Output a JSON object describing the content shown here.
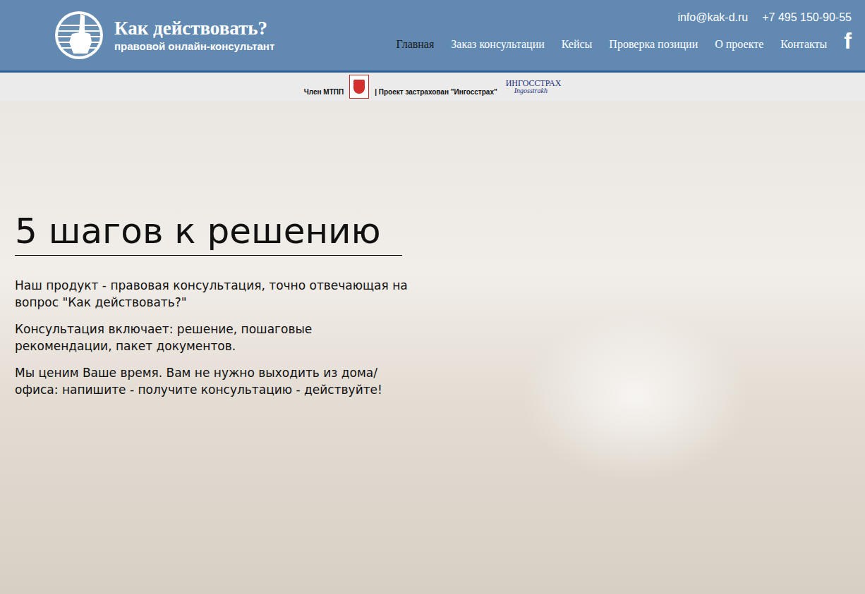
{
  "logo": {
    "title": "Как действовать?",
    "subtitle": "правовой онлайн-консультант"
  },
  "contacts": {
    "email": "info@kak-d.ru",
    "phone": "+7 495 150-90-55"
  },
  "nav": [
    {
      "label": "Главная",
      "selected": true
    },
    {
      "label": "Заказ консультации",
      "selected": false
    },
    {
      "label": "Кейсы",
      "selected": false
    },
    {
      "label": "Проверка позиции",
      "selected": false
    },
    {
      "label": "О проекте",
      "selected": false
    },
    {
      "label": "Контакты",
      "selected": false
    }
  ],
  "social": {
    "icon": "f"
  },
  "badges": {
    "member": "Член МТПП",
    "insured": "| Проект застрахован \"Ингосстрах\"",
    "insurer_logo": "ИНГОССТРАХ",
    "insurer_logo_sub": "Ingosstrakh"
  },
  "hero": {
    "title": "5 шагов к решению",
    "paragraphs": [
      "Наш продукт - правовая консультация, точно отвечающая на вопрос \"Как действовать?\"",
      "Консультация включает: решение, пошаговые рекомендации, пакет документов.",
      "Мы ценим Ваше время. Вам не нужно выходить из дома/офиса: напишите - получите консультацию - действуйте!"
    ]
  }
}
